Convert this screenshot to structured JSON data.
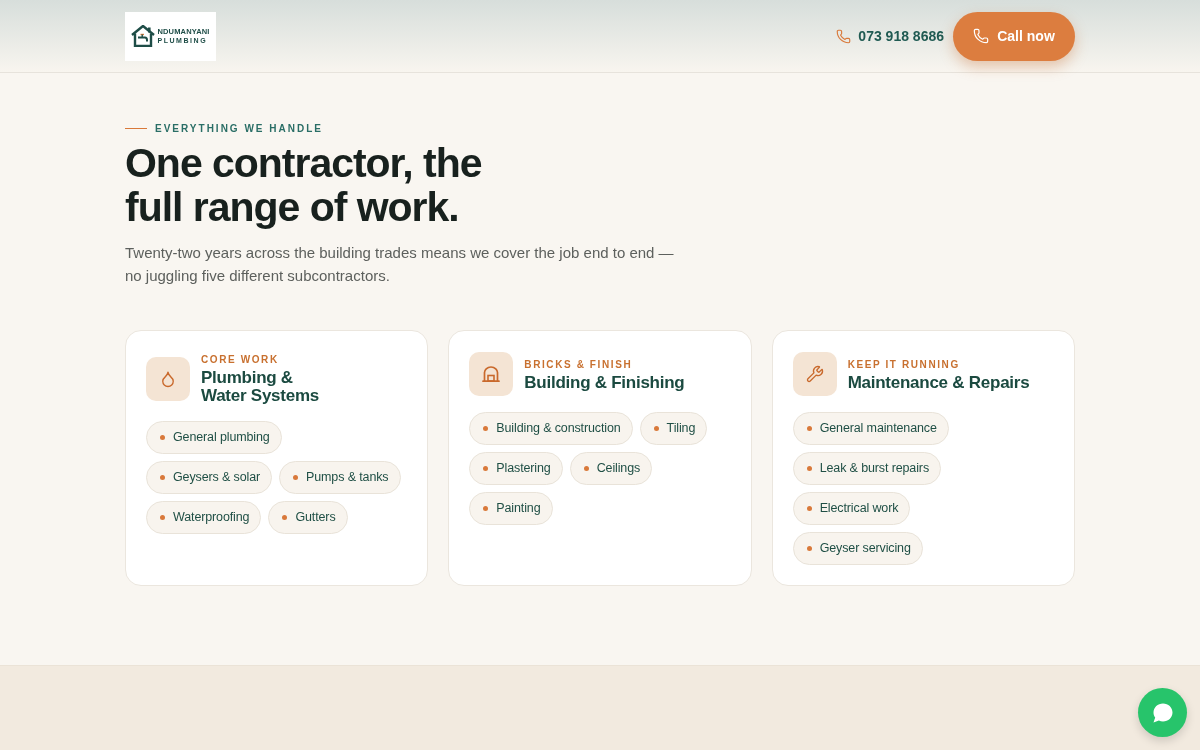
{
  "header": {
    "logo": {
      "name": "NDUMANYANI",
      "subtitle": "PLUMBING"
    },
    "phone": "073 918 8686",
    "call_button": "Call now"
  },
  "section": {
    "eyebrow": "EVERYTHING WE HANDLE",
    "heading_lines": [
      "One contractor, the",
      "full range of work."
    ],
    "intro": "Twenty-two years across the building trades means we cover the job end to end — no juggling five different subcontractors."
  },
  "cards": [
    {
      "eyebrow": "CORE WORK",
      "title": "Plumbing & Water Systems",
      "services": [
        "General plumbing",
        "Geysers & solar",
        "Pumps & tanks",
        "Waterproofing",
        "Gutters"
      ]
    },
    {
      "eyebrow": "BRICKS & FINISH",
      "title": "Building & Finishing",
      "services": [
        "Building & construction",
        "Tiling",
        "Plastering",
        "Ceilings",
        "Painting"
      ]
    },
    {
      "eyebrow": "KEEP IT RUNNING",
      "title": "Maintenance & Repairs",
      "services": [
        "General maintenance",
        "Leak & burst repairs",
        "Electrical work",
        "Geyser servicing"
      ]
    }
  ]
}
